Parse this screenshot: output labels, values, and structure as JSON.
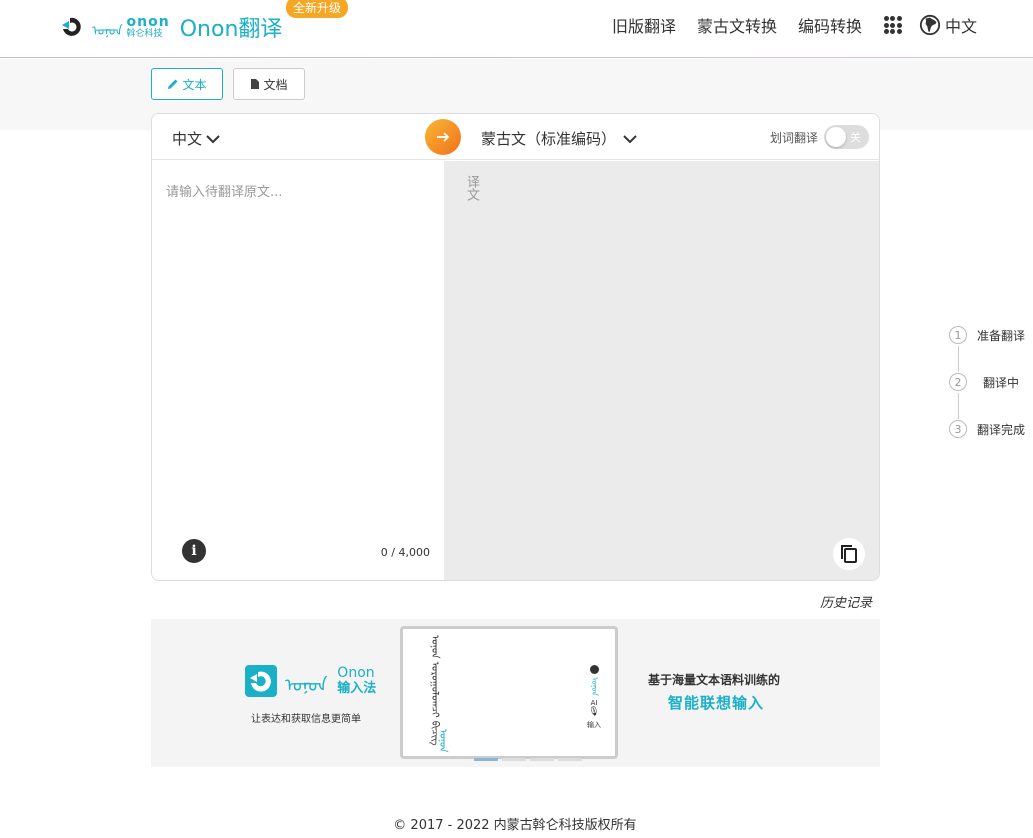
{
  "header": {
    "logo_mongol": "ᠣᠨᠣᠨ",
    "logo_en": "onon",
    "logo_cn": "斡仑科技",
    "title": "Onon翻译",
    "badge": "全新升级",
    "nav": [
      "旧版翻译",
      "蒙古文转换",
      "编码转换"
    ],
    "lang": "中文"
  },
  "tabs": {
    "text_label": "文本",
    "doc_label": "文档"
  },
  "translator": {
    "source_lang": "中文",
    "target_lang": "蒙古文（标准编码）",
    "hover_translate_label": "划词翻译",
    "toggle_state": "关",
    "input_placeholder": "请输入待翻译原文...",
    "char_count": "0 / 4,000",
    "output_placeholder": "译文"
  },
  "steps": [
    {
      "num": "1",
      "label": "准备翻译"
    },
    {
      "num": "2",
      "label": "翻译中"
    },
    {
      "num": "3",
      "label": "翻译完成"
    }
  ],
  "history_label": "历史记录",
  "banner": {
    "mongol": "ᠣᠨᠣᠨ",
    "brand_en": "Onon",
    "brand_cn": "输入法",
    "slogan": "让表达和获取信息更简单",
    "phone_text": "ᠣᠨᠣᠨ ᠤᠷᠤᠭᠤᠯᠤᠭᠴᠢ ᠪᠢᠴᠢᠭ",
    "phone_mongol": "ᠣᠨᠣᠨ",
    "phone_side_text": "ᠣᠨᠣᠨ",
    "phone_ai": "AI",
    "phone_cn": "输入",
    "right_line1": "基于海量文本语料训练的",
    "right_line2": "智能联想输入"
  },
  "footer": "© 2017 - 2022 内蒙古斡仑科技版权所有",
  "colors": {
    "accent": "#1ab0c8",
    "badge": "#f5a623",
    "swap_start": "#f7b733",
    "swap_end": "#f2711c",
    "target_bg": "#ebebeb"
  }
}
